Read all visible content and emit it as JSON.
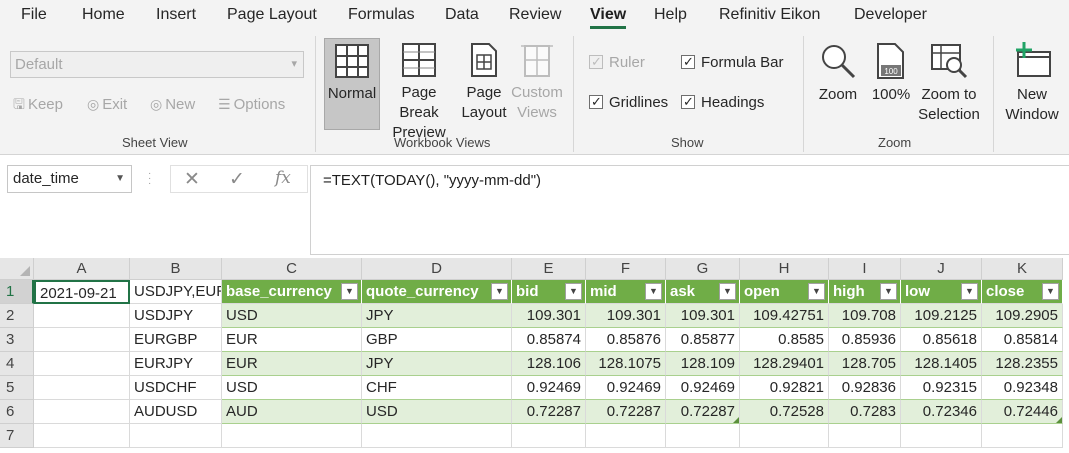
{
  "ribbon": {
    "tabs": [
      "File",
      "Home",
      "Insert",
      "Page Layout",
      "Formulas",
      "Data",
      "Review",
      "View",
      "Help",
      "Refinitiv Eikon",
      "Developer"
    ],
    "active_tab": "View",
    "sheet_view": {
      "dropdown_value": "Default",
      "keep": "Keep",
      "exit": "Exit",
      "new": "New",
      "options": "Options",
      "label": "Sheet View"
    },
    "workbook_views": {
      "normal": "Normal",
      "page_break_preview": "Page Break\nPreview",
      "page_layout": "Page\nLayout",
      "custom_views": "Custom\nViews",
      "label": "Workbook Views"
    },
    "show": {
      "ruler": "Ruler",
      "formula_bar": "Formula Bar",
      "gridlines": "Gridlines",
      "headings": "Headings",
      "label": "Show"
    },
    "zoom": {
      "zoom": "Zoom",
      "hundred": "100%",
      "zoom_to_selection": "Zoom to\nSelection",
      "label": "Zoom"
    },
    "window": {
      "new_window": "New\nWindow"
    }
  },
  "formula_bar": {
    "name_box": "date_time",
    "cancel_glyph": "✕",
    "enter_glyph": "✓",
    "fx_glyph": "fx",
    "formula": "=TEXT(TODAY(), \"yyyy-mm-dd\")"
  },
  "sheet": {
    "columns": [
      "A",
      "B",
      "C",
      "D",
      "E",
      "F",
      "G",
      "H",
      "I",
      "J",
      "K"
    ],
    "rows": [
      "1",
      "2",
      "3",
      "4",
      "5",
      "6",
      "7"
    ],
    "row1": {
      "a": "2021-09-21",
      "b": "USDJPY,EUR",
      "headers": [
        "base_currency",
        "quote_currency",
        "bid",
        "mid",
        "ask",
        "open",
        "high",
        "low",
        "close"
      ]
    },
    "table_rows": [
      {
        "pair": "USDJPY",
        "base": "USD",
        "quote": "JPY",
        "bid": "109.301",
        "mid": "109.301",
        "ask": "109.301",
        "open": "109.42751",
        "high": "109.708",
        "low": "109.2125",
        "close": "109.2905"
      },
      {
        "pair": "EURGBP",
        "base": "EUR",
        "quote": "GBP",
        "bid": "0.85874",
        "mid": "0.85876",
        "ask": "0.85877",
        "open": "0.8585",
        "high": "0.85936",
        "low": "0.85618",
        "close": "0.85814"
      },
      {
        "pair": "EURJPY",
        "base": "EUR",
        "quote": "JPY",
        "bid": "128.106",
        "mid": "128.1075",
        "ask": "128.109",
        "open": "128.29401",
        "high": "128.705",
        "low": "128.1405",
        "close": "128.2355"
      },
      {
        "pair": "USDCHF",
        "base": "USD",
        "quote": "CHF",
        "bid": "0.92469",
        "mid": "0.92469",
        "ask": "0.92469",
        "open": "0.92821",
        "high": "0.92836",
        "low": "0.92315",
        "close": "0.92348"
      },
      {
        "pair": "AUDUSD",
        "base": "AUD",
        "quote": "USD",
        "bid": "0.72287",
        "mid": "0.72287",
        "ask": "0.72287",
        "open": "0.72528",
        "high": "0.7283",
        "low": "0.72346",
        "close": "0.72446"
      }
    ]
  },
  "colors": {
    "accent": "#217346",
    "table_header": "#70ad47",
    "table_band": "#e2efda"
  }
}
